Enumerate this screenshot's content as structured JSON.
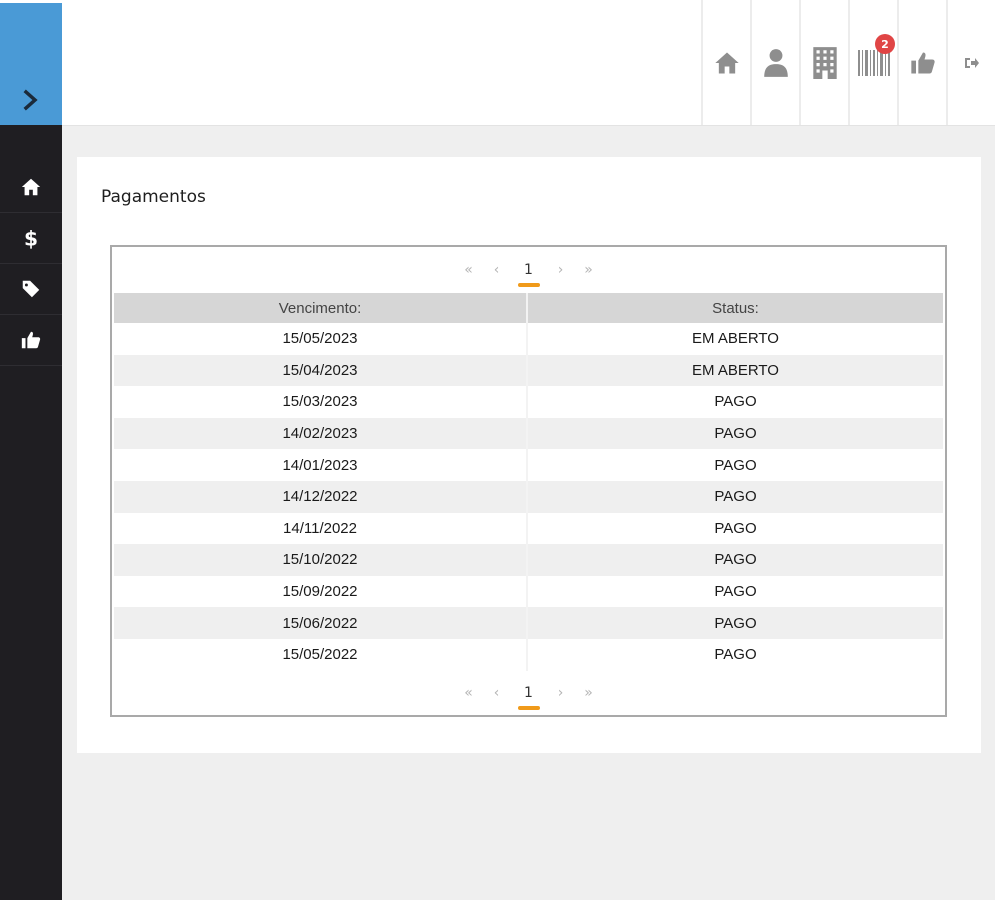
{
  "sidebar": {
    "toggle_icon": "chevron-right-icon",
    "items": [
      {
        "icon": "home-icon"
      },
      {
        "icon": "dollar-icon"
      },
      {
        "icon": "tag-icon"
      },
      {
        "icon": "thumbs-up-icon"
      }
    ],
    "accent_color": "#4a9ad6"
  },
  "topbar": {
    "icons": [
      {
        "icon": "home-icon"
      },
      {
        "icon": "user-icon"
      },
      {
        "icon": "building-icon"
      },
      {
        "icon": "barcode-icon",
        "badge": "2"
      },
      {
        "icon": "thumbs-up-icon"
      },
      {
        "icon": "logout-icon"
      }
    ]
  },
  "panel": {
    "title": "Pagamentos"
  },
  "pager": {
    "first": "«",
    "prev": "‹",
    "current": "1",
    "next": "›",
    "last": "»",
    "active_color": "#f09a1a"
  },
  "table": {
    "headers": [
      "Vencimento:",
      "Status:"
    ],
    "rows": [
      [
        "15/05/2023",
        "EM ABERTO"
      ],
      [
        "15/04/2023",
        "EM ABERTO"
      ],
      [
        "15/03/2023",
        "PAGO"
      ],
      [
        "14/02/2023",
        "PAGO"
      ],
      [
        "14/01/2023",
        "PAGO"
      ],
      [
        "14/12/2022",
        "PAGO"
      ],
      [
        "14/11/2022",
        "PAGO"
      ],
      [
        "15/10/2022",
        "PAGO"
      ],
      [
        "15/09/2022",
        "PAGO"
      ],
      [
        "15/06/2022",
        "PAGO"
      ],
      [
        "15/05/2022",
        "PAGO"
      ]
    ]
  }
}
